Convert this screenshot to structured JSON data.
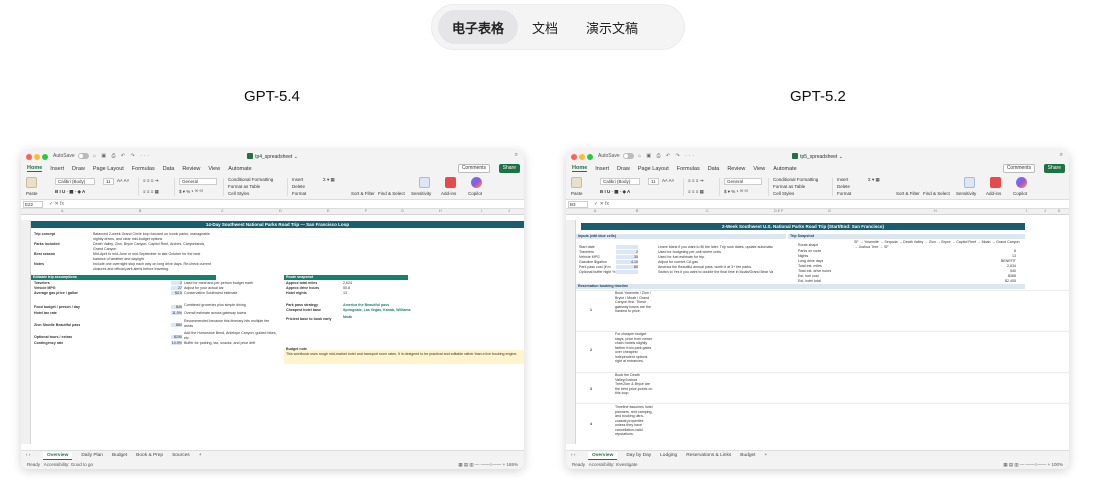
{
  "tabs": [
    {
      "label": "电子表格",
      "active": true
    },
    {
      "label": "文档",
      "active": false
    },
    {
      "label": "演示文稿",
      "active": false
    }
  ],
  "left": {
    "model": "GPT-5.4",
    "filename": "tp4_spreadsheet",
    "autosave": "AutoSave",
    "cell_ref": "E22",
    "banner": "14-Day Southwest National Parks Road Trip — San Francisco Loop",
    "info_rows": [
      {
        "label": "Trip concept",
        "value": "Balanced 2-week Grand Circle loop focused on iconic parks, manageable nightly drives, and clear mid-budget options"
      },
      {
        "label": "Parks included",
        "value": "Death Valley, Zion, Bryce Canyon, Capitol Reef, Arches, Canyonlands, Grand Canyon"
      },
      {
        "label": "Best season",
        "value": "Mid-April to mid-June or mid-September to late October for the best balance of weather and daylight"
      },
      {
        "label": "Notes",
        "value": "Include one overnight stop each way on long drive days. Re-check current closures and official park alerts before traveling."
      }
    ],
    "assumptions_header": "Editable trip assumptions",
    "assumptions": [
      {
        "label": "Travelers",
        "value": "2",
        "note": "Used for meal and per-person budget math"
      },
      {
        "label": "Vehicle MPG",
        "value": "27",
        "note": "Adjust for your actual car"
      },
      {
        "label": "Average gas price / gallon",
        "value": "$4.5",
        "note": "Conservative Southwest estimate"
      },
      {
        "label": "Food budget / person / day",
        "value": "$45",
        "note": "Combined groceries plus simple dining"
      },
      {
        "label": "Hotel tax rate",
        "value": "11.0%",
        "note": "Overall estimate across gateway towns"
      },
      {
        "label": "Zion Shuttle Beautiful pass",
        "value": "$80",
        "note": "Recommended because this itinerary hits multiple fee areas"
      },
      {
        "label": "Optional tours / extras",
        "value": "$250",
        "note": "Add the Horseshoe Bend, Antelope Canyon, guided hikes, etc."
      },
      {
        "label": "Contingency rate",
        "value": "10.0%",
        "note": "Buffer for parking, tax, snacks, and price drift"
      }
    ],
    "route_header": "Route snapshot",
    "route": [
      {
        "label": "Approx total miles",
        "value": "2,624"
      },
      {
        "label": "Approx drive hours",
        "value": "50.8"
      },
      {
        "label": "Hotel nights",
        "value": "13"
      },
      {
        "label": "Park pass strategy",
        "value": "America the Beautiful pass"
      },
      {
        "label": "Cheapest hotel base",
        "value": "Springdale, Las Vegas, Kanab, Williams"
      },
      {
        "label": "Priciest base to book early",
        "value": "Moab"
      }
    ],
    "budget_header": "Budget note",
    "budget_note": "This workbook uses rough mid-market hotel and transport room rates. It is designed to be practical and editable rather than a live booking engine.",
    "sheets": [
      "Overview",
      "Daily Plan",
      "Budget",
      "Book & Prep",
      "Sources"
    ],
    "status": "Ready",
    "accessibility": "Accessibility: Good to go",
    "zoom": "165%"
  },
  "right": {
    "model": "GPT-5.2",
    "filename": "tp5_spreadsheet",
    "autosave": "AutoSave",
    "cell_ref": "B3",
    "banner": "2-Week Southwest U.S. National Parks Road Trip (Start/End: San Francisco)",
    "inputs_header": "Inputs (edit blue cells)",
    "trip_header": "Trip Snapshot",
    "inputs": [
      {
        "label": "Start date",
        "value": "",
        "note": "Leave blank if you want to fill the later. Trip runs dates, update automatically."
      },
      {
        "label": "Travelers",
        "value": "2",
        "note": "Used for budgeting per-unit where units."
      },
      {
        "label": "Vehicle MPG",
        "value": "30",
        "note": "Used for fuel estimate for trip."
      },
      {
        "label": "Gasoline $/gallon",
        "value": "4.10",
        "note": "Adjust for current CA gas."
      },
      {
        "label": "Park pass cost (if m",
        "value": "80",
        "note": "America the Beautiful annual pass, worth it at 3+ fee parks."
      },
      {
        "label": "Optional buffer night %",
        "value": "",
        "note": "Switch to Yes if you want to double the final time in Moab/Grand Bear Valley."
      }
    ],
    "snapshot": [
      {
        "label": "Route shape",
        "value": "SF → Yosemite → Sequoia → Death Valley → Zion → Bryce → Capitol Reef → Moab → Grand Canyon → Joshua Tree → SF"
      },
      {
        "label": "Parks on route",
        "value": "8"
      },
      {
        "label": "Nights",
        "value": "13"
      },
      {
        "label": "Long drive days",
        "value": "BENEFIT"
      },
      {
        "label": "Total est. miles",
        "value": "2,634"
      },
      {
        "label": "Total est. drive hours",
        "value": "540"
      },
      {
        "label": "Est. fuel cost",
        "value": "$368"
      },
      {
        "label": "Est. hotel total",
        "value": "$2,405"
      }
    ],
    "booking_header": "Reservation booking timeline",
    "booking": [
      {
        "num": "1",
        "text": "Book Yosemite / Zion / Bryce / Moab / Grand Canyon first. These gateway towns are the hardest to price."
      },
      {
        "num": "2",
        "text": "For cheaper budget stays, price from newer chain motels slightly farther from park gates over cheapest independent options right at entrances."
      },
      {
        "num": "3",
        "text": "Book the Death Valley/Joshua Tree/Zion & Bryce are the best price-points on this loop."
      },
      {
        "num": "4",
        "text": "Timeline assumes hotel planners, rent camping, and booking ultra-coastal properties unless they have cancellation-valid reputations."
      }
    ],
    "sheets": [
      "Overview",
      "Day by Day",
      "Lodging",
      "Reservations & Links",
      "Budget"
    ],
    "status": "Ready",
    "accessibility": "Accessibility: Investigate",
    "zoom": "100%"
  },
  "ribbon": {
    "menu": [
      "Home",
      "Insert",
      "Draw",
      "Page Layout",
      "Formulas",
      "Data",
      "Review",
      "View",
      "Automate"
    ],
    "font": "Calibri (Body)",
    "font_size": "11",
    "number_format": "General",
    "paste": "Paste",
    "conditional": "Conditional Formatting",
    "format_table": "Format as Table",
    "cell_styles": "Cell Styles",
    "insert": "Insert",
    "delete": "Delete",
    "format": "Format",
    "sort": "Sort & Filter",
    "find": "Find & Select",
    "sensitivity": "Sensitivity",
    "addins": "Add-ins",
    "copilot": "Copilot",
    "comments": "Comments",
    "share": "Share"
  }
}
